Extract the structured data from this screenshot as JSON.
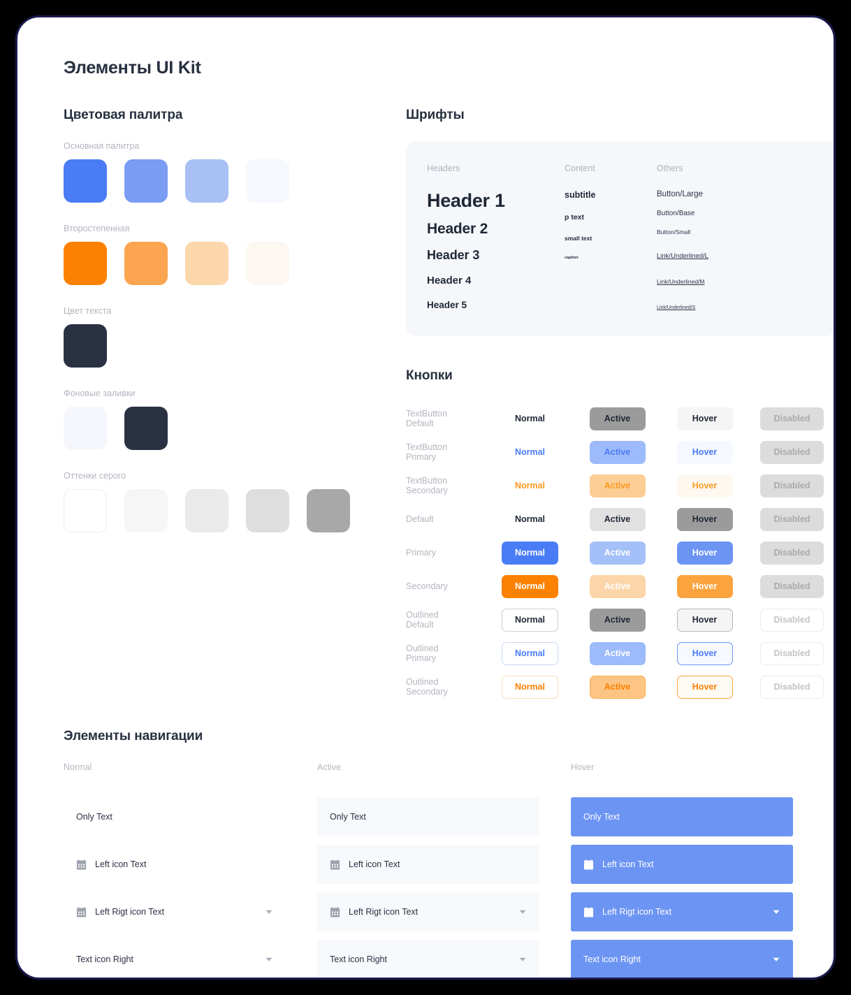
{
  "page": {
    "title": "Элементы UI Kit"
  },
  "palette": {
    "section_title": "Цветовая палитра",
    "groups": [
      {
        "label": "Основная палитра",
        "colors": [
          "#4a7cf6",
          "#7a9cf3",
          "#a8c0f4",
          "#f6f8fe"
        ]
      },
      {
        "label": "Второстепенная",
        "colors": [
          "#fc8100",
          "#fba551",
          "#fcd7ab",
          "#fdf7f1"
        ]
      },
      {
        "label": "Цвет текста",
        "colors": [
          "#2a3142"
        ]
      },
      {
        "label": "Фоновые заливки",
        "colors": [
          "#f6f7fc",
          "#2a3142"
        ]
      },
      {
        "label": "Оттенки серого",
        "colors": [
          "#ffffff",
          "#f6f6f6",
          "#eaeaea",
          "#dedede",
          "#a8a8a8"
        ]
      }
    ]
  },
  "fonts": {
    "section_title": "Шрифты",
    "columns": [
      {
        "title": "Headers",
        "items": [
          "Header 1",
          "Header 2",
          "Header 3",
          "Header 4",
          "Header 5"
        ]
      },
      {
        "title": "Content",
        "items": [
          "subtitle",
          "p text",
          "small text",
          "caption"
        ]
      },
      {
        "title": "Others",
        "items": [
          "Button/Large",
          "Button/Base",
          "Button/Small",
          "Link/Underlined/L",
          "Link/Underlined/M",
          "Link/Underlined/S"
        ]
      }
    ]
  },
  "buttons": {
    "section_title": "Кнопки",
    "state_labels": [
      "Normal",
      "Active",
      "Hover",
      "Disabled"
    ],
    "rows": [
      {
        "label": "TextButton\nDefault",
        "cells": [
          {
            "text": "Normal",
            "bg": "transparent",
            "fg": "#1f2735",
            "border": "transparent"
          },
          {
            "text": "Active",
            "bg": "#9b9b9b",
            "fg": "#1f2735",
            "border": "transparent"
          },
          {
            "text": "Hover",
            "bg": "#f5f5f5",
            "fg": "#1f2735",
            "border": "transparent"
          },
          {
            "text": "Disabled",
            "bg": "#dcdcdc",
            "fg": "#aaaaaa",
            "border": "transparent"
          }
        ]
      },
      {
        "label": "TextButton\nPrimary",
        "cells": [
          {
            "text": "Normal",
            "bg": "transparent",
            "fg": "#4a7cf6",
            "border": "transparent"
          },
          {
            "text": "Active",
            "bg": "#9dbafa",
            "fg": "#4a7cf6",
            "border": "transparent"
          },
          {
            "text": "Hover",
            "bg": "#f5f8fe",
            "fg": "#4a7cf6",
            "border": "transparent"
          },
          {
            "text": "Disabled",
            "bg": "#dcdcdc",
            "fg": "#aaaaaa",
            "border": "transparent"
          }
        ]
      },
      {
        "label": "TextButton\nSecondary",
        "cells": [
          {
            "text": "Normal",
            "bg": "transparent",
            "fg": "#fb9a21",
            "border": "transparent"
          },
          {
            "text": "Active",
            "bg": "#fcce96",
            "fg": "#fb9a21",
            "border": "transparent"
          },
          {
            "text": "Hover",
            "bg": "#fef8f1",
            "fg": "#fb9a21",
            "border": "transparent"
          },
          {
            "text": "Disabled",
            "bg": "#dcdcdc",
            "fg": "#aaaaaa",
            "border": "transparent"
          }
        ]
      },
      {
        "label": "Default",
        "cells": [
          {
            "text": "Normal",
            "bg": "transparent",
            "fg": "#1f2735",
            "border": "transparent"
          },
          {
            "text": "Active",
            "bg": "#e1e1e1",
            "fg": "#1f2735",
            "border": "transparent"
          },
          {
            "text": "Hover",
            "bg": "#9b9b9b",
            "fg": "#1f2735",
            "border": "transparent"
          },
          {
            "text": "Disabled",
            "bg": "#dcdcdc",
            "fg": "#aaaaaa",
            "border": "transparent"
          }
        ]
      },
      {
        "label": "Primary",
        "cells": [
          {
            "text": "Normal",
            "bg": "#4a7cf6",
            "fg": "#ffffff",
            "border": "transparent"
          },
          {
            "text": "Active",
            "bg": "#a3c0f8",
            "fg": "#ffffff",
            "border": "transparent"
          },
          {
            "text": "Hover",
            "bg": "#6c94f3",
            "fg": "#ffffff",
            "border": "transparent"
          },
          {
            "text": "Disabled",
            "bg": "#dcdcdc",
            "fg": "#aaaaaa",
            "border": "transparent"
          }
        ]
      },
      {
        "label": "Secondary",
        "cells": [
          {
            "text": "Normal",
            "bg": "#fc8100",
            "fg": "#ffffff",
            "border": "transparent"
          },
          {
            "text": "Active",
            "bg": "#fcd5a8",
            "fg": "#ffffff",
            "border": "transparent"
          },
          {
            "text": "Hover",
            "bg": "#fba33f",
            "fg": "#ffffff",
            "border": "transparent"
          },
          {
            "text": "Disabled",
            "bg": "#dcdcdc",
            "fg": "#aaaaaa",
            "border": "transparent"
          }
        ]
      },
      {
        "label": "Outlined\nDefault",
        "cells": [
          {
            "text": "Normal",
            "bg": "#ffffff",
            "fg": "#1f2735",
            "border": "#cfcfcf"
          },
          {
            "text": "Active",
            "bg": "#9b9b9b",
            "fg": "#1f2735",
            "border": "transparent"
          },
          {
            "text": "Hover",
            "bg": "#f5f5f5",
            "fg": "#1f2735",
            "border": "#b6b6b6"
          },
          {
            "text": "Disabled",
            "bg": "#ffffff",
            "fg": "#c4c4c4",
            "border": "#ececec"
          }
        ]
      },
      {
        "label": "Outlined\nPrimary",
        "cells": [
          {
            "text": "Normal",
            "bg": "#ffffff",
            "fg": "#4a7cf6",
            "border": "#c8d8fa"
          },
          {
            "text": "Active",
            "bg": "#9dbafa",
            "fg": "#ffffff",
            "border": "transparent"
          },
          {
            "text": "Hover",
            "bg": "#f6f9ff",
            "fg": "#4a7cf6",
            "border": "#6c94f3"
          },
          {
            "text": "Disabled",
            "bg": "#ffffff",
            "fg": "#c4c4c4",
            "border": "#ececec"
          }
        ]
      },
      {
        "label": "Outlined\nSecondary",
        "cells": [
          {
            "text": "Normal",
            "bg": "#ffffff",
            "fg": "#fc8100",
            "border": "#fbdcb9"
          },
          {
            "text": "Active",
            "bg": "#fcc583",
            "fg": "#fc8100",
            "border": "#fbab51"
          },
          {
            "text": "Hover",
            "bg": "#fefaf4",
            "fg": "#fc8100",
            "border": "#fba33f"
          },
          {
            "text": "Disabled",
            "bg": "#ffffff",
            "fg": "#c4c4c4",
            "border": "#ececec"
          }
        ]
      }
    ]
  },
  "navigation": {
    "section_title": "Элементы навигации",
    "columns": [
      {
        "title": "Normal",
        "bg": "transparent",
        "fg": "#2a3142",
        "icon_color": "#9aa0ab",
        "caret_color": "#a9aeb8",
        "items": [
          {
            "label": "Only Text",
            "left_icon": false,
            "right_icon": false
          },
          {
            "label": "Left icon Text",
            "left_icon": true,
            "right_icon": false
          },
          {
            "label": "Left Rigt icon Text",
            "left_icon": true,
            "right_icon": true
          },
          {
            "label": "Text icon Right",
            "left_icon": false,
            "right_icon": true
          }
        ]
      },
      {
        "title": "Active",
        "bg": "#f7f9fc",
        "fg": "#2a3142",
        "icon_color": "#9aa0ab",
        "caret_color": "#a9aeb8",
        "items": [
          {
            "label": "Only Text",
            "left_icon": false,
            "right_icon": false
          },
          {
            "label": "Left icon Text",
            "left_icon": true,
            "right_icon": false
          },
          {
            "label": "Left Rigt icon Text",
            "left_icon": true,
            "right_icon": true
          },
          {
            "label": "Text icon Right",
            "left_icon": false,
            "right_icon": true
          }
        ]
      },
      {
        "title": "Hover",
        "bg": "#6c94f3",
        "fg": "#ffffff",
        "icon_color": "#ffffff",
        "caret_color": "#ffffff",
        "items": [
          {
            "label": "Only Text",
            "left_icon": false,
            "right_icon": false
          },
          {
            "label": "Left icon Text",
            "left_icon": true,
            "right_icon": false
          },
          {
            "label": "Left Rigt icon Text",
            "left_icon": true,
            "right_icon": true
          },
          {
            "label": "Text icon Right",
            "left_icon": false,
            "right_icon": true
          }
        ]
      }
    ]
  },
  "icons": {
    "calendar": "calendar-icon",
    "caret": "chevron-down-icon"
  }
}
